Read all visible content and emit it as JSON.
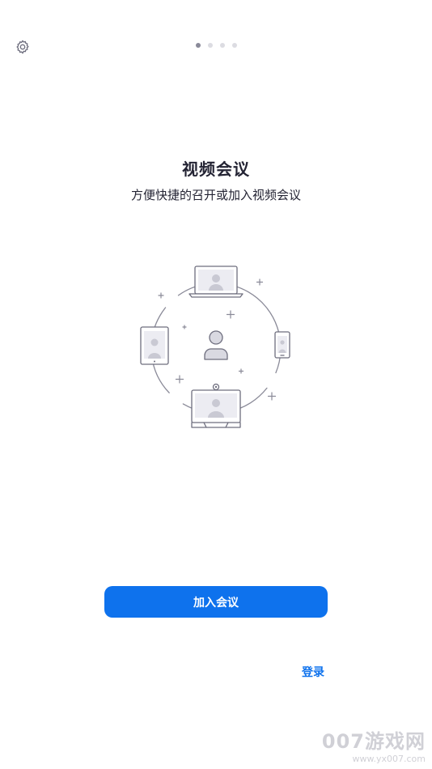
{
  "header": {
    "settings_icon": "gear-icon",
    "pager": {
      "total": 4,
      "active_index": 0
    }
  },
  "main": {
    "title": "视频会议",
    "subtitle": "方便快捷的召开或加入视频会议",
    "illustration_icon": "video-meeting-devices-illustration"
  },
  "actions": {
    "join_label": "加入会议",
    "login_label": "登录"
  },
  "watermark": {
    "main": "007游戏网",
    "url": "www.yx007.com"
  },
  "colors": {
    "primary": "#0e72ed",
    "text": "#232333",
    "dot_active": "#8a8a99",
    "dot_inactive": "#dcdce2"
  }
}
